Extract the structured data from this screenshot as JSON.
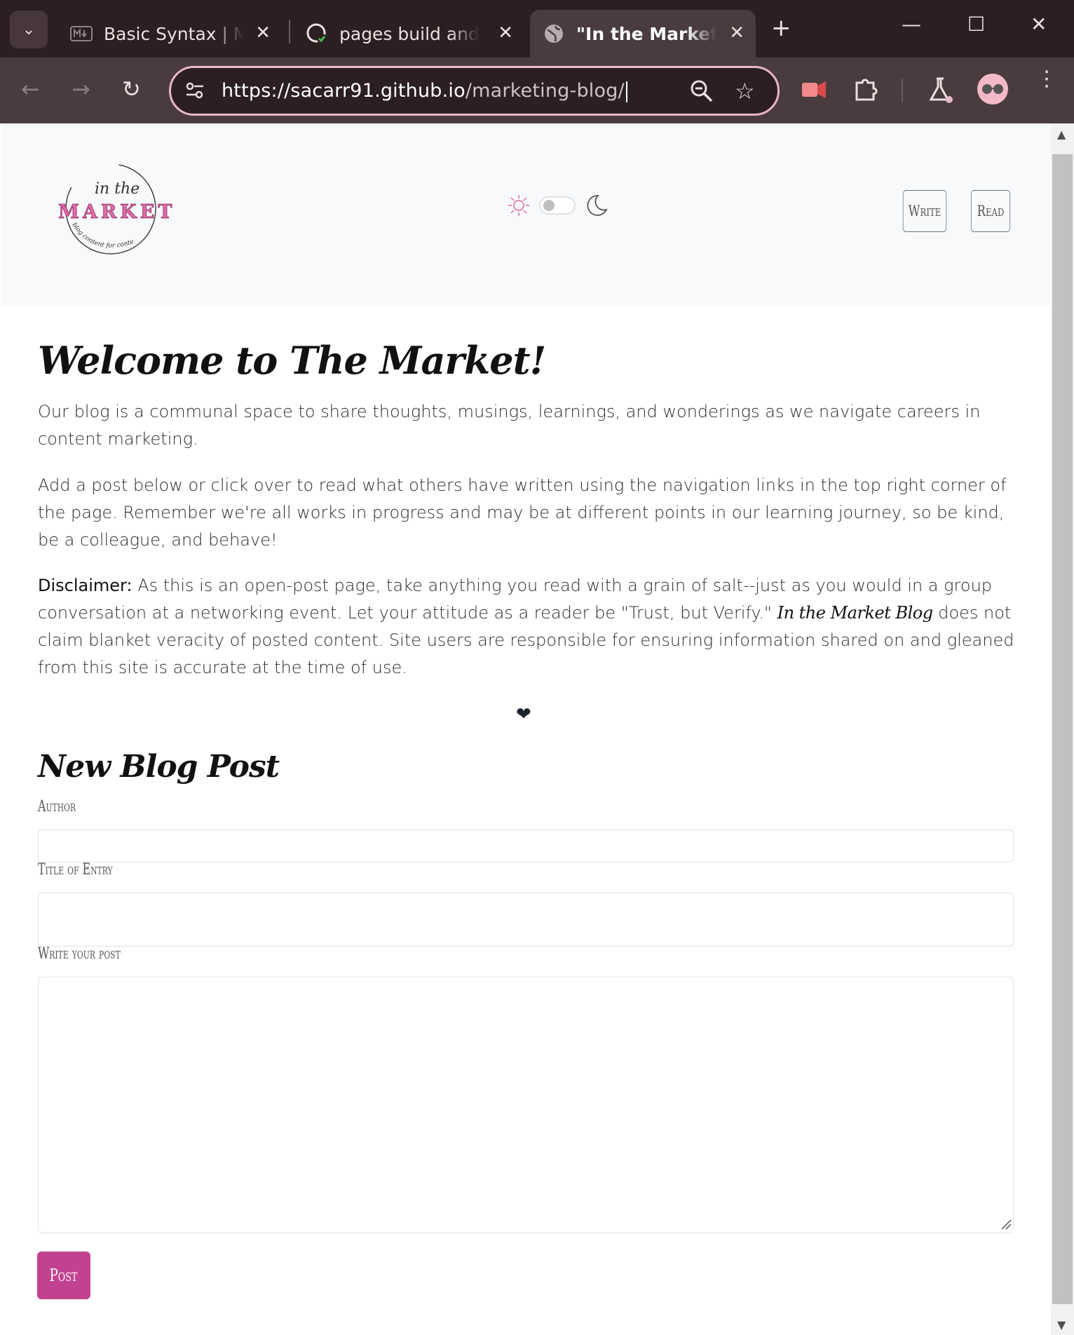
{
  "browser": {
    "tabs": [
      {
        "title": "Basic Syntax | Markdown Guide",
        "favicon": "markdown-icon",
        "active": false
      },
      {
        "title": "pages build and deployment",
        "favicon": "github-icon",
        "active": false
      },
      {
        "title": "\"In the Market\" Home",
        "favicon": "globe-icon",
        "active": true
      }
    ],
    "url_host": "https://sacarr91.github.io",
    "url_path": "/marketing-blog/",
    "accent": "#e7b7c6"
  },
  "header": {
    "logo_alt": "in the MARKET",
    "logo_top": "in the",
    "logo_main": "MARKET",
    "logo_tagline": "blog content for content marketing",
    "nav": {
      "write": "Write",
      "read": "Read"
    }
  },
  "intro": {
    "title": "Welcome to The Market!",
    "p1": "Our blog is a communal space to share thoughts, musings, learnings, and wonderings as we navigate careers in content marketing.",
    "p2": "Add a post below or click over to read what others have written using the navigation links in the top right corner of the page. Remember we're all works in progress and may be at different points in our learning journey, so be kind, be a colleague, and behave!",
    "disclaimer_label": "Disclaimer:",
    "disclaimer_a": " As this is an open-post page, take anything you read with a grain of salt--just as you would in a group conversation at a networking event. Let your attitude as a reader be \"Trust, but Verify.\" ",
    "disclaimer_brand": "In the Market Blog",
    "disclaimer_b": " does not claim blanket veracity of posted content. Site users are responsible for ensuring information shared on and gleaned from this site is accurate at the time of use.",
    "divider": "❤"
  },
  "form": {
    "title": "New Blog Post",
    "author_label": "Author",
    "author_value": "",
    "title_label": "Title of Entry",
    "title_value": "",
    "post_label": "Write your post",
    "post_value": "",
    "submit": "Post",
    "submit_color": "#c2428f"
  }
}
